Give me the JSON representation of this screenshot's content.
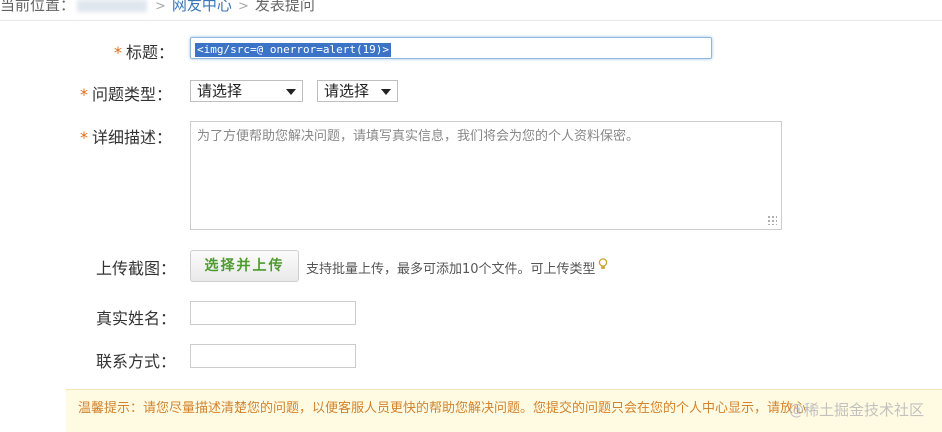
{
  "breadcrumb": {
    "prefix": "当前位置：",
    "items": [
      "网友中心",
      "发表提问"
    ]
  },
  "form": {
    "title_label": "标题：",
    "title_value": "<img/src=@ onerror=alert(19)>",
    "type_label": "问题类型：",
    "type_select_1": "请选择",
    "type_select_2": "请选择",
    "detail_label": "详细描述：",
    "detail_placeholder": "为了方便帮助您解决问题，请填写真实信息，我们将会为您的个人资料保密。",
    "upload_label": "上传截图：",
    "upload_button": "选择并上传",
    "upload_hint": "支持批量上传，最多可添加10个文件。可上传类型",
    "name_label": "真实姓名：",
    "contact_label": "联系方式：",
    "required_mark": "*"
  },
  "tip": {
    "text": "温馨提示：请您尽量描述清楚您的问题，以便客服人员更快的帮助您解决问题。您提交的问题只会在您的个人中心显示，请放心"
  },
  "watermark": "@稀土掘金技术社区",
  "colors": {
    "required": "#e06c1a",
    "link": "#3a76b8",
    "selection": "#3b73c7",
    "upload_text": "#4d9a2e",
    "tip_bg": "#fffbe3",
    "tip_text": "#d2832e"
  },
  "icons": {
    "breadcrumb_separator": "chevron-right-icon",
    "select_arrow": "caret-down-icon",
    "hint": "lightbulb-icon",
    "resize": "resize-grip-icon"
  }
}
